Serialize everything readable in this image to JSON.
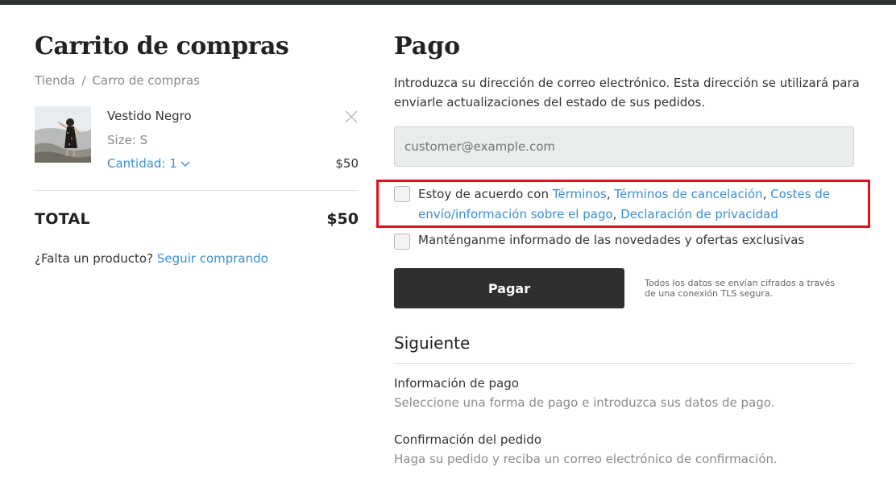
{
  "cart": {
    "title": "Carrito de compras",
    "breadcrumb": {
      "home": "Tienda",
      "separator": "/",
      "current": "Carro de compras"
    },
    "item": {
      "name": "Vestido Negro",
      "size": "Size: S",
      "quantity_label": "Cantidad: 1",
      "price": "$50",
      "remove_icon": "close-icon"
    },
    "total_label": "TOTAL",
    "total_value": "$50",
    "missing_text": "¿Falta un producto?",
    "continue_link": "Seguir comprando"
  },
  "payment": {
    "title": "Pago",
    "intro": "Introduzca su dirección de correo electrónico. Esta dirección se utilizará para enviarle actualizaciones del estado de sus pedidos.",
    "email_placeholder": "customer@example.com",
    "terms": {
      "prefix": "Estoy de acuerdo con",
      "link_terms": "Términos",
      "link_cancel": "Términos de cancelación",
      "link_shipping": "Costes de envío/información sobre el pago",
      "link_privacy": "Declaración de privacidad",
      "checked": false
    },
    "newsletter": {
      "label": "Manténganme informado de las novedades y ofertas exclusivas",
      "checked": false
    },
    "pay_button": "Pagar",
    "secure_note": "Todos los datos se envían cifrados a través de una conexión TLS segura."
  },
  "next": {
    "title": "Siguiente",
    "steps": [
      {
        "title": "Información de pago",
        "desc": "Seleccione una forma de pago e introduzca sus datos de pago."
      },
      {
        "title": "Confirmación del pedido",
        "desc": "Haga su pedido y reciba un correo electrónico de confirmación."
      }
    ]
  },
  "colors": {
    "link": "#3b8fcf",
    "button": "#2f2f2f",
    "highlight": "#e0111b",
    "topbar": "#2e3330"
  }
}
